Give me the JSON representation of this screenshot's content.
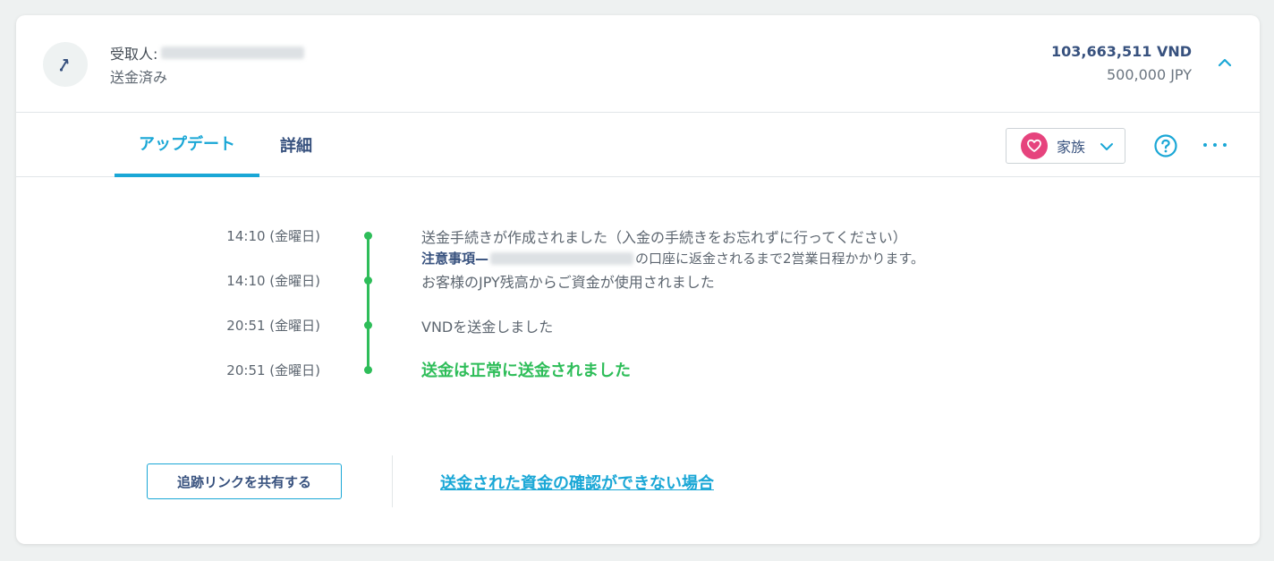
{
  "header": {
    "recipient_label": "受取人:",
    "status": "送金済み",
    "amount_target": "103,663,511 VND",
    "amount_source": "500,000 JPY"
  },
  "tabs": [
    {
      "label": "アップデート",
      "active": true
    },
    {
      "label": "詳細",
      "active": false
    }
  ],
  "category": {
    "label": "家族",
    "icon": "heart-icon"
  },
  "timeline": [
    {
      "time": "14:10 (金曜日)",
      "text": "送金手続きが作成されました（入金の手続きをお忘れずに行ってください）"
    },
    {
      "time": "14:10 (金曜日)",
      "text": "お客様のJPY残高からご資金が使用されました"
    },
    {
      "time": "20:51 (金曜日)",
      "text": "VNDを送金しました"
    },
    {
      "time": "20:51 (金曜日)",
      "text": "送金は正常に送金されました"
    }
  ],
  "note": {
    "label": "注意事項—",
    "text": "の口座に返金されるまで2営業日程かかります。"
  },
  "footer": {
    "share_button": "追跡リンクを共有する",
    "help_link": "送金された資金の確認ができない場合"
  },
  "colors": {
    "accent": "#1aa7d6",
    "success": "#2ebd59",
    "navy": "#37517e",
    "heart": "#e6437d"
  }
}
